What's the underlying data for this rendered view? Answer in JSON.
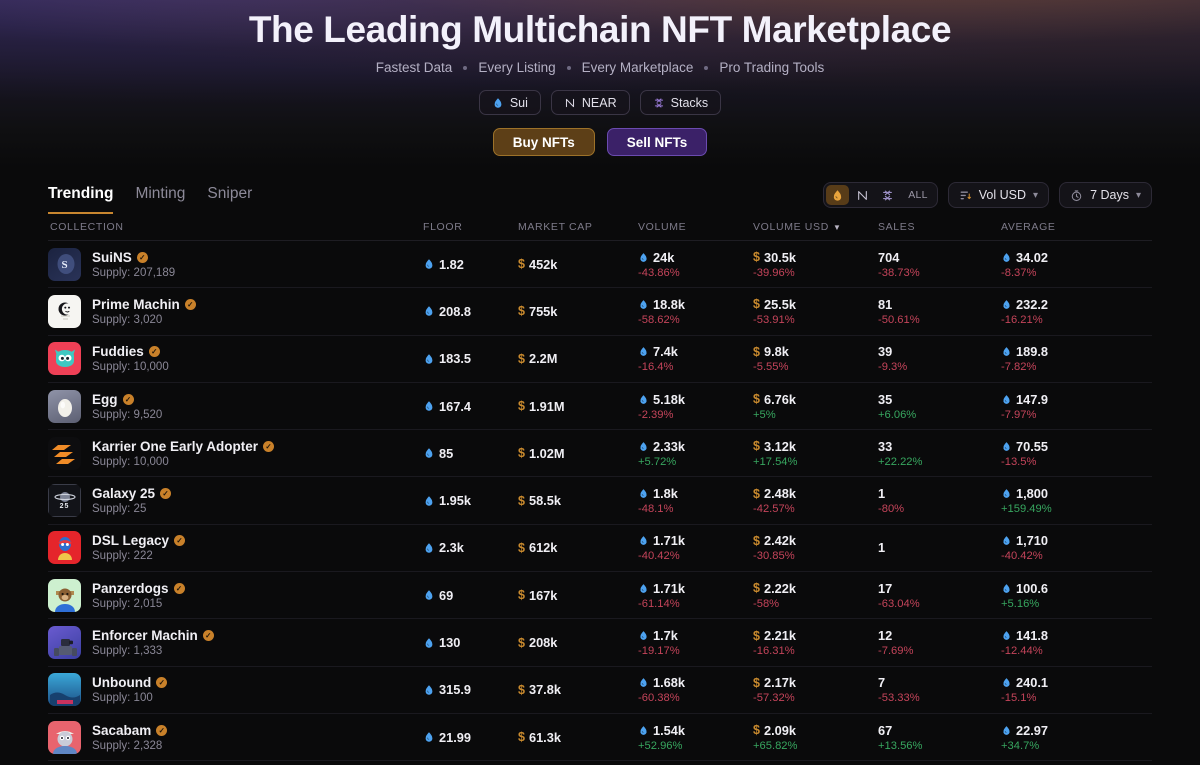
{
  "hero": {
    "title": "The Leading Multichain NFT Marketplace",
    "tagline": [
      "Fastest Data",
      "Every Listing",
      "Every Marketplace",
      "Pro Trading Tools"
    ],
    "chains": [
      {
        "label": "Sui",
        "icon": "sui-droplet-icon"
      },
      {
        "label": "NEAR",
        "icon": "near-icon"
      },
      {
        "label": "Stacks",
        "icon": "stacks-icon"
      }
    ],
    "cta": {
      "buy": "Buy NFTs",
      "sell": "Sell NFTs"
    }
  },
  "toolbar": {
    "tabs": [
      {
        "label": "Trending",
        "active": true
      },
      {
        "label": "Minting",
        "active": false
      },
      {
        "label": "Sniper",
        "active": false
      }
    ],
    "chain_toggle": [
      {
        "key": "sui",
        "label": "",
        "icon": "sui-droplet-icon",
        "active": true
      },
      {
        "key": "near",
        "label": "",
        "icon": "near-icon",
        "active": false
      },
      {
        "key": "stacks",
        "label": "",
        "icon": "stacks-icon",
        "active": false
      },
      {
        "key": "all",
        "label": "ALL",
        "icon": "",
        "active": false
      }
    ],
    "sort": {
      "label": "Vol USD",
      "icon": "sort-descending-icon",
      "chevron": "⌄"
    },
    "timeframe": {
      "label": "7 Days",
      "icon": "clock-icon",
      "chevron": "⌄"
    }
  },
  "table": {
    "columns": [
      "COLLECTION",
      "FLOOR",
      "MARKET CAP",
      "VOLUME",
      "VOLUME USD",
      "SALES",
      "AVERAGE"
    ],
    "sorted_column": "VOLUME USD",
    "sort_direction": "desc",
    "colors": {
      "up": "#37a65f",
      "down": "#c4445a",
      "sui": "#4da2f0",
      "usd": "#c98a2e",
      "accent": "#c8862f"
    },
    "rows": [
      {
        "name": "SuiNS",
        "verified": true,
        "supply": "Supply: 207,189",
        "floor": "1.82",
        "mcap": "452k",
        "volume": "24k",
        "volume_change": "-43.86%",
        "volume_usd": "30.5k",
        "volume_usd_change": "-39.96%",
        "sales": "704",
        "sales_change": "-38.73%",
        "average": "34.02",
        "average_change": "-8.37%"
      },
      {
        "name": "Prime Machin",
        "verified": true,
        "supply": "Supply: 3,020",
        "floor": "208.8",
        "mcap": "755k",
        "volume": "18.8k",
        "volume_change": "-58.62%",
        "volume_usd": "25.5k",
        "volume_usd_change": "-53.91%",
        "sales": "81",
        "sales_change": "-50.61%",
        "average": "232.2",
        "average_change": "-16.21%"
      },
      {
        "name": "Fuddies",
        "verified": true,
        "supply": "Supply: 10,000",
        "floor": "183.5",
        "mcap": "2.2M",
        "volume": "7.4k",
        "volume_change": "-16.4%",
        "volume_usd": "9.8k",
        "volume_usd_change": "-5.55%",
        "sales": "39",
        "sales_change": "-9.3%",
        "average": "189.8",
        "average_change": "-7.82%"
      },
      {
        "name": "Egg",
        "verified": true,
        "supply": "Supply: 9,520",
        "floor": "167.4",
        "mcap": "1.91M",
        "volume": "5.18k",
        "volume_change": "-2.39%",
        "volume_usd": "6.76k",
        "volume_usd_change": "+5%",
        "sales": "35",
        "sales_change": "+6.06%",
        "average": "147.9",
        "average_change": "-7.97%"
      },
      {
        "name": "Karrier One Early Adopter",
        "verified": true,
        "supply": "Supply: 10,000",
        "floor": "85",
        "mcap": "1.02M",
        "volume": "2.33k",
        "volume_change": "+5.72%",
        "volume_usd": "3.12k",
        "volume_usd_change": "+17.54%",
        "sales": "33",
        "sales_change": "+22.22%",
        "average": "70.55",
        "average_change": "-13.5%"
      },
      {
        "name": "Galaxy 25",
        "verified": true,
        "supply": "Supply: 25",
        "floor": "1.95k",
        "mcap": "58.5k",
        "volume": "1.8k",
        "volume_change": "-48.1%",
        "volume_usd": "2.48k",
        "volume_usd_change": "-42.57%",
        "sales": "1",
        "sales_change": "-80%",
        "average": "1,800",
        "average_change": "+159.49%"
      },
      {
        "name": "DSL Legacy",
        "verified": true,
        "supply": "Supply: 222",
        "floor": "2.3k",
        "mcap": "612k",
        "volume": "1.71k",
        "volume_change": "-40.42%",
        "volume_usd": "2.42k",
        "volume_usd_change": "-30.85%",
        "sales": "1",
        "sales_change": "",
        "average": "1,710",
        "average_change": "-40.42%"
      },
      {
        "name": "Panzerdogs",
        "verified": true,
        "supply": "Supply: 2,015",
        "floor": "69",
        "mcap": "167k",
        "volume": "1.71k",
        "volume_change": "-61.14%",
        "volume_usd": "2.22k",
        "volume_usd_change": "-58%",
        "sales": "17",
        "sales_change": "-63.04%",
        "average": "100.6",
        "average_change": "+5.16%"
      },
      {
        "name": "Enforcer Machin",
        "verified": true,
        "supply": "Supply: 1,333",
        "floor": "130",
        "mcap": "208k",
        "volume": "1.7k",
        "volume_change": "-19.17%",
        "volume_usd": "2.21k",
        "volume_usd_change": "-16.31%",
        "sales": "12",
        "sales_change": "-7.69%",
        "average": "141.8",
        "average_change": "-12.44%"
      },
      {
        "name": "Unbound",
        "verified": true,
        "supply": "Supply: 100",
        "floor": "315.9",
        "mcap": "37.8k",
        "volume": "1.68k",
        "volume_change": "-60.38%",
        "volume_usd": "2.17k",
        "volume_usd_change": "-57.32%",
        "sales": "7",
        "sales_change": "-53.33%",
        "average": "240.1",
        "average_change": "-15.1%"
      },
      {
        "name": "Sacabam",
        "verified": true,
        "supply": "Supply: 2,328",
        "floor": "21.99",
        "mcap": "61.3k",
        "volume": "1.54k",
        "volume_change": "+52.96%",
        "volume_usd": "2.09k",
        "volume_usd_change": "+65.82%",
        "sales": "67",
        "sales_change": "+13.56%",
        "average": "22.97",
        "average_change": "+34.7%"
      }
    ]
  }
}
